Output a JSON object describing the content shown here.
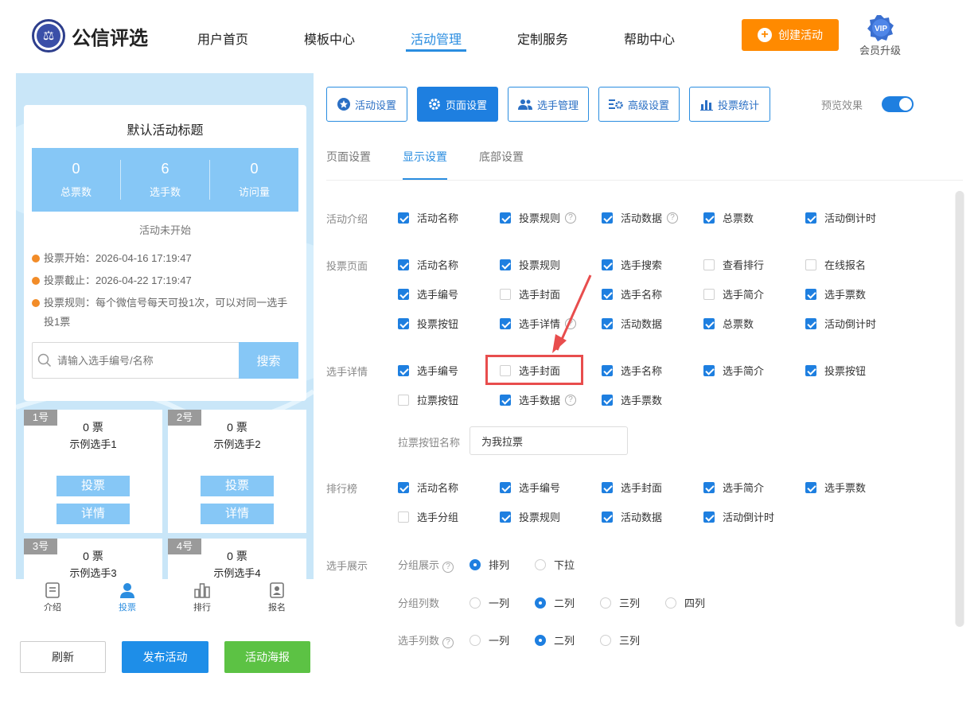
{
  "header": {
    "brand": "公信评选",
    "nav": [
      "用户首页",
      "模板中心",
      "活动管理",
      "定制服务",
      "帮助中心"
    ],
    "active_nav": "活动管理",
    "create_label": "创建活动",
    "vip_badge": "VIP",
    "vip_label": "会员升级"
  },
  "preview": {
    "title": "默认活动标题",
    "stats": [
      {
        "value": "0",
        "label": "总票数"
      },
      {
        "value": "6",
        "label": "选手数"
      },
      {
        "value": "0",
        "label": "访问量"
      }
    ],
    "status": "活动未开始",
    "vote_start": "投票开始：2026-04-16 17:19:47",
    "vote_end": "投票截止：2026-04-22 17:19:47",
    "vote_rule": "投票规则：每个微信号每天可投1次，可以对同一选手投1票",
    "search_placeholder": "请输入选手编号/名称",
    "search_btn": "搜索",
    "candidates": [
      {
        "num": "1号",
        "votes": "0 票",
        "name": "示例选手1",
        "vote_btn": "投票",
        "detail_btn": "详情"
      },
      {
        "num": "2号",
        "votes": "0 票",
        "name": "示例选手2",
        "vote_btn": "投票",
        "detail_btn": "详情"
      },
      {
        "num": "3号",
        "votes": "0 票",
        "name": "示例选手3"
      },
      {
        "num": "4号",
        "votes": "0 票",
        "name": "示例选手4"
      }
    ],
    "tabbar": [
      "介绍",
      "投票",
      "排行",
      "报名"
    ],
    "active_tab": "投票"
  },
  "bottom_buttons": {
    "refresh": "刷新",
    "publish": "发布活动",
    "poster": "活动海报"
  },
  "toolbar": {
    "tools": [
      "活动设置",
      "页面设置",
      "选手管理",
      "高级设置",
      "投票统计"
    ],
    "active_tool": "页面设置",
    "preview_label": "预览效果",
    "preview_on": true
  },
  "subtabs": {
    "items": [
      "页面设置",
      "显示设置",
      "底部设置"
    ],
    "active": "显示设置"
  },
  "sections": {
    "intro": {
      "label": "活动介绍",
      "items": [
        {
          "label": "活动名称",
          "checked": true
        },
        {
          "label": "投票规则",
          "checked": true,
          "help": true
        },
        {
          "label": "活动数据",
          "checked": true,
          "help": true
        },
        {
          "label": "总票数",
          "checked": true
        },
        {
          "label": "活动倒计时",
          "checked": true
        }
      ]
    },
    "vote_page": {
      "label": "投票页面",
      "items": [
        {
          "label": "活动名称",
          "checked": true
        },
        {
          "label": "投票规则",
          "checked": true
        },
        {
          "label": "选手搜索",
          "checked": true
        },
        {
          "label": "查看排行",
          "checked": false
        },
        {
          "label": "在线报名",
          "checked": false
        },
        {
          "label": "选手编号",
          "checked": true
        },
        {
          "label": "选手封面",
          "checked": false
        },
        {
          "label": "选手名称",
          "checked": true
        },
        {
          "label": "选手简介",
          "checked": false
        },
        {
          "label": "选手票数",
          "checked": true
        },
        {
          "label": "投票按钮",
          "checked": true
        },
        {
          "label": "选手详情",
          "checked": true,
          "help": true
        },
        {
          "label": "活动数据",
          "checked": true
        },
        {
          "label": "总票数",
          "checked": true
        },
        {
          "label": "活动倒计时",
          "checked": true
        }
      ]
    },
    "detail": {
      "label": "选手详情",
      "items": [
        {
          "label": "选手编号",
          "checked": true
        },
        {
          "label": "选手封面",
          "checked": false
        },
        {
          "label": "选手名称",
          "checked": true
        },
        {
          "label": "选手简介",
          "checked": true
        },
        {
          "label": "投票按钮",
          "checked": true
        },
        {
          "label": "拉票按钮",
          "checked": false
        },
        {
          "label": "选手数据",
          "checked": true,
          "help": true
        },
        {
          "label": "选手票数",
          "checked": true
        }
      ],
      "pull_label": "拉票按钮名称",
      "pull_value": "为我拉票"
    },
    "ranking": {
      "label": "排行榜",
      "items": [
        {
          "label": "活动名称",
          "checked": true
        },
        {
          "label": "选手编号",
          "checked": true
        },
        {
          "label": "选手封面",
          "checked": true
        },
        {
          "label": "选手简介",
          "checked": true
        },
        {
          "label": "选手票数",
          "checked": true
        },
        {
          "label": "选手分组",
          "checked": false
        },
        {
          "label": "投票规则",
          "checked": true
        },
        {
          "label": "活动数据",
          "checked": true
        },
        {
          "label": "活动倒计时",
          "checked": true
        }
      ]
    },
    "display": {
      "label": "选手展示",
      "group_display": {
        "label": "分组展示",
        "options": [
          "排列",
          "下拉"
        ],
        "selected": "排列"
      },
      "group_cols": {
        "label": "分组列数",
        "options": [
          "一列",
          "二列",
          "三列",
          "四列"
        ],
        "selected": "二列"
      },
      "cand_cols": {
        "label": "选手列数",
        "options": [
          "一列",
          "二列",
          "三列"
        ],
        "selected": "二列"
      }
    }
  }
}
